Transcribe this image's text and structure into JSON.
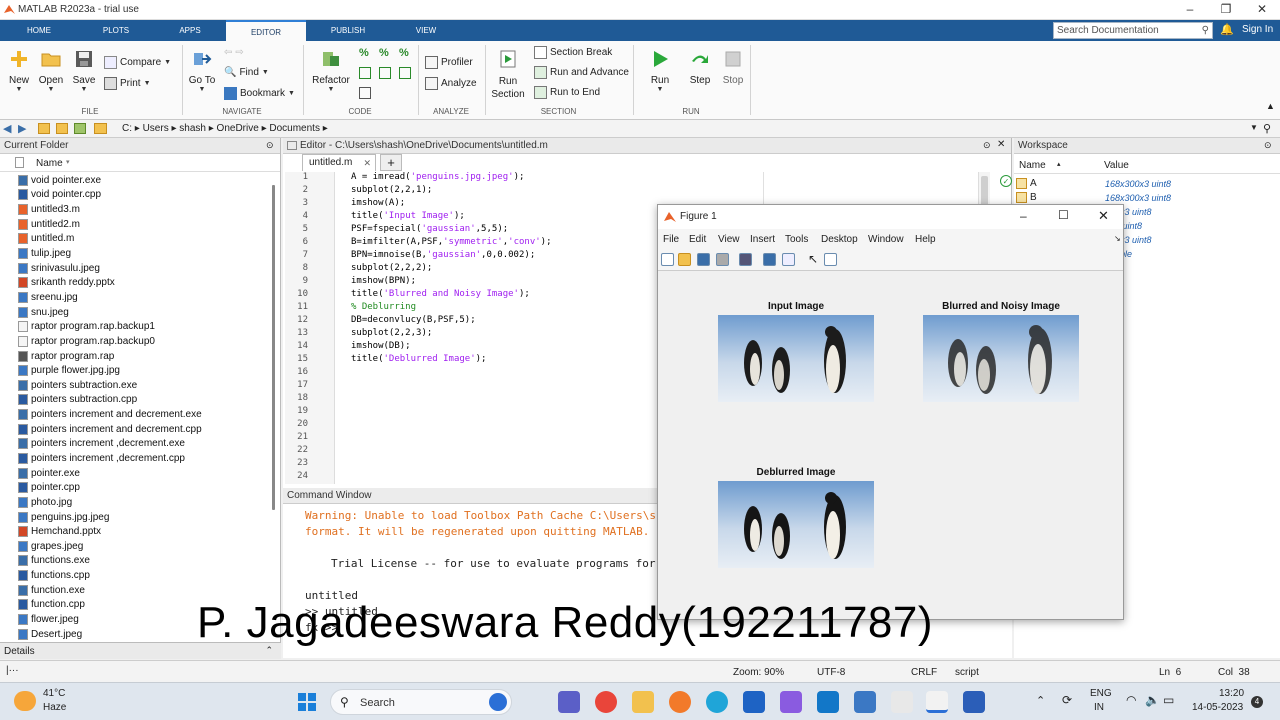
{
  "window": {
    "title": "MATLAB R2023a - trial use"
  },
  "ribbon_tabs": [
    "HOME",
    "PLOTS",
    "APPS",
    "EDITOR",
    "PUBLISH",
    "VIEW"
  ],
  "active_tab": "EDITOR",
  "search": {
    "placeholder": "Search Documentation"
  },
  "sign_in": "Sign In",
  "ribbon": {
    "file": {
      "label": "FILE",
      "new": "New",
      "open": "Open",
      "save": "Save",
      "compare": "Compare",
      "print": "Print"
    },
    "navigate": {
      "label": "NAVIGATE",
      "goto": "Go To",
      "find": "Find",
      "bookmark": "Bookmark"
    },
    "code": {
      "label": "CODE",
      "refactor": "Refactor"
    },
    "analyze": {
      "label": "ANALYZE",
      "profiler": "Profiler",
      "analyze": "Analyze"
    },
    "section": {
      "label": "SECTION",
      "run_section": "Run Section",
      "section_break": "Section Break",
      "run_advance": "Run and Advance",
      "run_end": "Run to End"
    },
    "run": {
      "label": "RUN",
      "run": "Run",
      "step": "Step",
      "stop": "Stop"
    }
  },
  "address": {
    "drive": "C:",
    "parts": [
      "Users",
      "shash",
      "OneDrive",
      "Documents"
    ]
  },
  "current_folder": {
    "title": "Current Folder",
    "column": "Name",
    "files": [
      {
        "name": "void pointer.exe",
        "type": "exe"
      },
      {
        "name": "void pointer.cpp",
        "type": "cpp"
      },
      {
        "name": "untitled3.m",
        "type": "m"
      },
      {
        "name": "untitled2.m",
        "type": "m"
      },
      {
        "name": "untitled.m",
        "type": "m"
      },
      {
        "name": "tulip.jpeg",
        "type": "img"
      },
      {
        "name": "srinivasulu.jpeg",
        "type": "img"
      },
      {
        "name": "srikanth reddy.pptx",
        "type": "pptx"
      },
      {
        "name": "sreenu.jpg",
        "type": "img"
      },
      {
        "name": "snu.jpeg",
        "type": "img"
      },
      {
        "name": "raptor program.rap.backup1",
        "type": "file"
      },
      {
        "name": "raptor program.rap.backup0",
        "type": "file"
      },
      {
        "name": "raptor program.rap",
        "type": "rap"
      },
      {
        "name": "purple flower.jpg.jpg",
        "type": "img"
      },
      {
        "name": "pointers subtraction.exe",
        "type": "exe"
      },
      {
        "name": "pointers subtraction.cpp",
        "type": "cpp"
      },
      {
        "name": "pointers increment and decrement.exe",
        "type": "exe"
      },
      {
        "name": "pointers increment and decrement.cpp",
        "type": "cpp"
      },
      {
        "name": "pointers increment ,decrement.exe",
        "type": "exe"
      },
      {
        "name": "pointers increment ,decrement.cpp",
        "type": "cpp"
      },
      {
        "name": "pointer.exe",
        "type": "exe"
      },
      {
        "name": "pointer.cpp",
        "type": "cpp"
      },
      {
        "name": "photo.jpg",
        "type": "img"
      },
      {
        "name": "penguins.jpg.jpeg",
        "type": "img"
      },
      {
        "name": "Hemchand.pptx",
        "type": "pptx"
      },
      {
        "name": "grapes.jpeg",
        "type": "img"
      },
      {
        "name": "functions.exe",
        "type": "exe"
      },
      {
        "name": "functions.cpp",
        "type": "cpp"
      },
      {
        "name": "function.exe",
        "type": "exe"
      },
      {
        "name": "function.cpp",
        "type": "cpp"
      },
      {
        "name": "flower.jpeg",
        "type": "img"
      },
      {
        "name": "Desert.jpeg",
        "type": "img"
      }
    ]
  },
  "details_label": "Details",
  "editor": {
    "header": "Editor - C:\\Users\\shash\\OneDrive\\Documents\\untitled.m",
    "tab": "untitled.m",
    "lines": [
      {
        "n": "1",
        "parts": [
          {
            "t": "A = imread(",
            "c": ""
          },
          {
            "t": "'penguins.jpg.jpeg'",
            "c": "str"
          },
          {
            "t": ");",
            "c": ""
          }
        ]
      },
      {
        "n": "2",
        "parts": [
          {
            "t": "subplot(2,2,1);",
            "c": ""
          }
        ]
      },
      {
        "n": "3",
        "parts": [
          {
            "t": "imshow(A);",
            "c": ""
          }
        ]
      },
      {
        "n": "4",
        "parts": [
          {
            "t": "title(",
            "c": ""
          },
          {
            "t": "'Input Image'",
            "c": "str"
          },
          {
            "t": ");",
            "c": ""
          }
        ]
      },
      {
        "n": "5",
        "parts": [
          {
            "t": "PSF=fspecial(",
            "c": ""
          },
          {
            "t": "'gaussian'",
            "c": "str"
          },
          {
            "t": ",5,5);",
            "c": ""
          }
        ]
      },
      {
        "n": "6",
        "parts": [
          {
            "t": "B=imfilter(A,PSF,",
            "c": ""
          },
          {
            "t": "'symmetric'",
            "c": "str"
          },
          {
            "t": ",",
            "c": ""
          },
          {
            "t": "'conv'",
            "c": "str"
          },
          {
            "t": ");",
            "c": ""
          }
        ]
      },
      {
        "n": "7",
        "parts": [
          {
            "t": "BPN=imnoise(B,",
            "c": ""
          },
          {
            "t": "'gaussian'",
            "c": "str"
          },
          {
            "t": ",0,0.002);",
            "c": ""
          }
        ]
      },
      {
        "n": "8",
        "parts": [
          {
            "t": "subplot(2,2,2);",
            "c": ""
          }
        ]
      },
      {
        "n": "9",
        "parts": [
          {
            "t": "imshow(BPN);",
            "c": ""
          }
        ]
      },
      {
        "n": "10",
        "parts": [
          {
            "t": "title(",
            "c": ""
          },
          {
            "t": "'Blurred and Noisy Image'",
            "c": "str"
          },
          {
            "t": ");",
            "c": ""
          }
        ]
      },
      {
        "n": "11",
        "parts": [
          {
            "t": "% Deblurring",
            "c": "cmt"
          }
        ]
      },
      {
        "n": "12",
        "parts": [
          {
            "t": "DB=deconvlucy(B,PSF,5);",
            "c": ""
          }
        ]
      },
      {
        "n": "13",
        "parts": [
          {
            "t": "subplot(2,2,3);",
            "c": ""
          }
        ]
      },
      {
        "n": "14",
        "parts": [
          {
            "t": "imshow(DB);",
            "c": ""
          }
        ]
      },
      {
        "n": "15",
        "parts": [
          {
            "t": "title(",
            "c": ""
          },
          {
            "t": "'Deblurred Image'",
            "c": "str"
          },
          {
            "t": ");",
            "c": ""
          }
        ]
      },
      {
        "n": "16",
        "parts": []
      },
      {
        "n": "17",
        "parts": []
      },
      {
        "n": "18",
        "parts": []
      },
      {
        "n": "19",
        "parts": []
      },
      {
        "n": "20",
        "parts": []
      },
      {
        "n": "21",
        "parts": []
      },
      {
        "n": "22",
        "parts": []
      },
      {
        "n": "23",
        "parts": []
      },
      {
        "n": "24",
        "parts": []
      }
    ]
  },
  "command_window": {
    "title": "Command Window",
    "warning1": "Warning: Unable to load Toolbox Path Cache C:\\Users\\s",
    "warning2": "format. It will be regenerated upon quitting MATLAB.",
    "license": "Trial License -- for use to evaluate programs for",
    "out1": "untitled",
    "out2": ">> untitled",
    "prompt": "fx >>"
  },
  "workspace": {
    "title": "Workspace",
    "col_name": "Name",
    "col_value": "Value",
    "vars": [
      {
        "name": "A",
        "value": "168x300x3 uint8"
      },
      {
        "name": "B",
        "value": "168x300x3 uint8"
      },
      {
        "name": "",
        "value": "300x3 uint8"
      },
      {
        "name": "",
        "value": "300 uint8"
      },
      {
        "name": "",
        "value": "300x3 uint8"
      },
      {
        "name": "",
        "value": "double"
      }
    ]
  },
  "status": {
    "zoom": "Zoom: 90%",
    "encoding": "UTF-8",
    "eol": "CRLF",
    "type": "script",
    "ln": "Ln  6",
    "col": "Col  38"
  },
  "figure": {
    "title": "Figure 1",
    "menu": [
      "File",
      "Edit",
      "View",
      "Insert",
      "Tools",
      "Desktop",
      "Window",
      "Help"
    ],
    "axes_titles": [
      "Input Image",
      "Blurred and Noisy Image",
      "Deblurred Image"
    ]
  },
  "watermark": "P. Jagadeeswara Reddy(192211787)",
  "taskbar": {
    "weather_temp": "41°C",
    "weather_desc": "Haze",
    "search": "Search",
    "lang1": "ENG",
    "lang2": "IN",
    "time": "13:20",
    "date": "14-05-2023",
    "notif": "4"
  },
  "colors": {
    "ribbon_blue": "#1f5a96",
    "string": "#a020f0",
    "comment": "#228b22",
    "warning": "#e07020",
    "ws_value": "#2060b0"
  }
}
